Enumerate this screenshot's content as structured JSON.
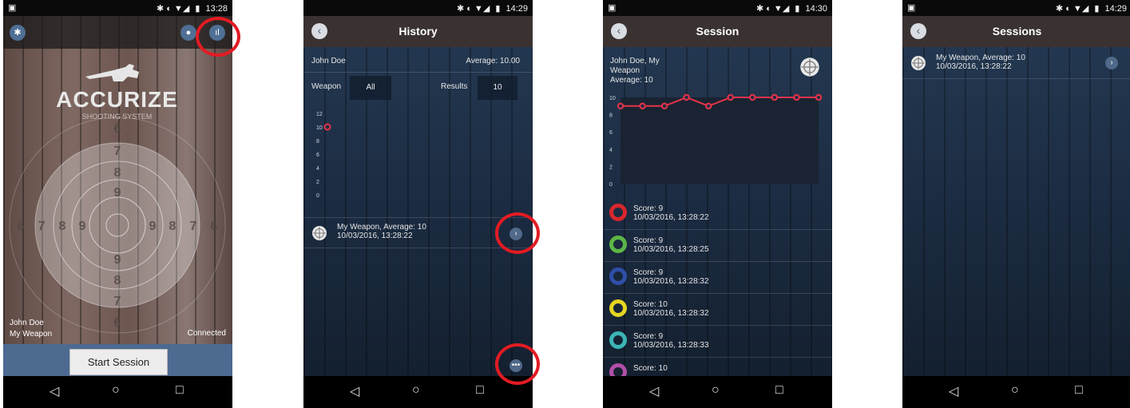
{
  "status": {
    "p1_time": "13:28",
    "p2_time": "14:29",
    "p3_time": "14:30",
    "p4_time": "14:29",
    "icons": "✱ ◐ ▼◢"
  },
  "screen1": {
    "logo_title": "ACCURIZE",
    "logo_sub": "SHOOTING SYSTEM",
    "user_name": "John Doe",
    "weapon": "My Weapon",
    "connection": "Connected",
    "start_button": "Start Session",
    "target_numbers": [
      "6",
      "7",
      "8",
      "9",
      "9",
      "8",
      "7",
      "6",
      "6",
      "7",
      "8",
      "9",
      "9",
      "8",
      "7",
      "6"
    ]
  },
  "screen2": {
    "title": "History",
    "user_name": "John Doe",
    "average_label": "Average: 10.00",
    "weapon_label": "Weapon",
    "weapon_value": "All",
    "results_label": "Results",
    "results_value": "10",
    "chart_data": {
      "type": "scatter",
      "yticks": [
        "12",
        "10",
        "8",
        "6",
        "4",
        "2",
        "0"
      ],
      "ylim": [
        0,
        12
      ],
      "points": [
        {
          "x": 1,
          "y": 10
        }
      ],
      "series_color": "#e8334a"
    },
    "entry_line1": "My Weapon, Average: 10",
    "entry_line2": "10/03/2016, 13:28:22"
  },
  "screen3": {
    "title": "Session",
    "header_line1": "John Doe, My",
    "header_line2": "Weapon",
    "header_line3": "Average: 10",
    "chart_data": {
      "type": "line",
      "yticks": [
        "10",
        "8",
        "6",
        "4",
        "2",
        "0"
      ],
      "ylim": [
        0,
        10
      ],
      "values": [
        9,
        9,
        9,
        10,
        9,
        10,
        10,
        10,
        10,
        10
      ],
      "series_color": "#e8334a"
    },
    "shots": [
      {
        "score": "Score: 9",
        "time": "10/03/2016, 13:28:22",
        "color": "#d8262c"
      },
      {
        "score": "Score: 9",
        "time": "10/03/2016, 13:28:25",
        "color": "#5cb646"
      },
      {
        "score": "Score: 9",
        "time": "10/03/2016, 13:28:32",
        "color": "#2f4fa8"
      },
      {
        "score": "Score: 10",
        "time": "10/03/2016, 13:28:32",
        "color": "#e6d422"
      },
      {
        "score": "Score: 9",
        "time": "10/03/2016, 13:28:33",
        "color": "#3bb5b5"
      },
      {
        "score": "Score: 10",
        "time": "",
        "color": "#b24fa8"
      }
    ]
  },
  "screen4": {
    "title": "Sessions",
    "entry_line1": "My Weapon, Average: 10",
    "entry_line2": "10/03/2016, 13:28:22"
  },
  "colors": {
    "highlight": "#e31b23",
    "accent_blue": "#4f6f95",
    "title_bar": "#3a3131"
  }
}
